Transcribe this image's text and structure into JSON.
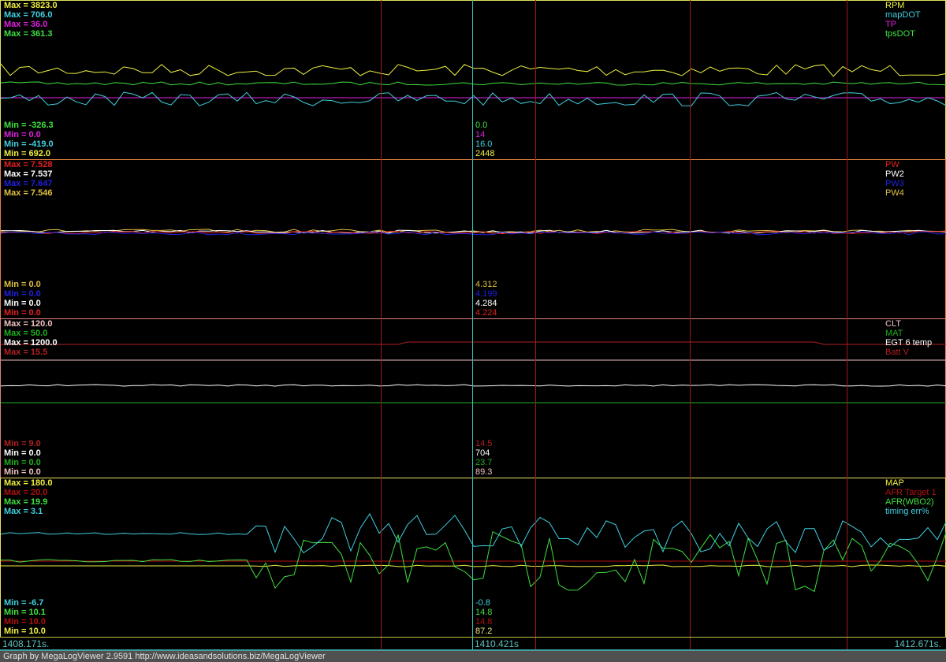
{
  "panels": [
    {
      "border": "#e0e060",
      "max": [
        {
          "t": "Max = 3823.0",
          "c": "#f0f040"
        },
        {
          "t": "Max = 706.0",
          "c": "#40d0e0"
        },
        {
          "t": "Max = 36.0",
          "c": "#e020e0"
        },
        {
          "t": "Max = 361.3",
          "c": "#40e040"
        }
      ],
      "min": [
        {
          "t": "Min = -326.3",
          "c": "#40e040"
        },
        {
          "t": "Min = 0.0",
          "c": "#e020e0"
        },
        {
          "t": "Min = -419.0",
          "c": "#40d0e0"
        },
        {
          "t": "Min = 692.0",
          "c": "#f0f040"
        }
      ],
      "legend": [
        {
          "t": "RPM",
          "c": "#f0f040"
        },
        {
          "t": "mapDOT",
          "c": "#40d0e0"
        },
        {
          "t": "TP",
          "c": "#e020e0"
        },
        {
          "t": "tpsDOT",
          "c": "#40e040"
        }
      ],
      "cursor": [
        {
          "t": "0.0",
          "c": "#40e040"
        },
        {
          "t": "14",
          "c": "#e020e0"
        },
        {
          "t": "16.0",
          "c": "#40d0e0"
        },
        {
          "t": "2448",
          "c": "#f0f040"
        }
      ]
    },
    {
      "border": "#e08040",
      "max": [
        {
          "t": "Max = 7.528",
          "c": "#e02020"
        },
        {
          "t": "Max = 7.537",
          "c": "#ffffff"
        },
        {
          "t": "Max = 7.647",
          "c": "#2020e0"
        },
        {
          "t": "Max = 7.546",
          "c": "#e0c040"
        }
      ],
      "min": [
        {
          "t": "Min = 0.0",
          "c": "#e0c040"
        },
        {
          "t": "Min = 0.0",
          "c": "#2020e0"
        },
        {
          "t": "Min = 0.0",
          "c": "#ffffff"
        },
        {
          "t": "Min = 0.0",
          "c": "#e02020"
        }
      ],
      "legend": [
        {
          "t": "PW",
          "c": "#e02020"
        },
        {
          "t": "PW2",
          "c": "#ffffff"
        },
        {
          "t": "PW3",
          "c": "#2020e0"
        },
        {
          "t": "PW4",
          "c": "#e0c040"
        }
      ],
      "cursor": [
        {
          "t": "4.312",
          "c": "#e0c040"
        },
        {
          "t": "4.199",
          "c": "#2020e0"
        },
        {
          "t": "4.284",
          "c": "#ffffff"
        },
        {
          "t": "4.224",
          "c": "#e02020"
        }
      ]
    },
    {
      "border": "#e08080",
      "max": [
        {
          "t": "Max = 120.0",
          "c": "#f0c0c0"
        },
        {
          "t": "Max = 50.0",
          "c": "#20b020"
        },
        {
          "t": "Max = 1200.0",
          "c": "#ffffff"
        },
        {
          "t": "Max = 15.5",
          "c": "#b02020"
        }
      ],
      "min": [
        {
          "t": "Min = 9.0",
          "c": "#b02020"
        },
        {
          "t": "Min = 0.0",
          "c": "#ffffff"
        },
        {
          "t": "Min = 0.0",
          "c": "#20b020"
        },
        {
          "t": "Min = 0.0",
          "c": "#f0c0c0"
        }
      ],
      "legend": [
        {
          "t": "CLT",
          "c": "#f0c0c0"
        },
        {
          "t": "MAT",
          "c": "#20b020"
        },
        {
          "t": "EGT 6 temp",
          "c": "#ffffff"
        },
        {
          "t": "Batt V",
          "c": "#b02020"
        }
      ],
      "cursor": [
        {
          "t": "14.5",
          "c": "#b02020"
        },
        {
          "t": "704",
          "c": "#ffffff"
        },
        {
          "t": "23.7",
          "c": "#20b020"
        },
        {
          "t": "89.3",
          "c": "#f0c0c0"
        }
      ]
    },
    {
      "border": "#f0e060",
      "max": [
        {
          "t": "Max = 180.0",
          "c": "#f0f040"
        },
        {
          "t": "Max = 20.0",
          "c": "#b01010"
        },
        {
          "t": "Max = 19.9",
          "c": "#40e040"
        },
        {
          "t": "Max = 3.1",
          "c": "#40d0e0"
        }
      ],
      "min": [
        {
          "t": "Min = -6.7",
          "c": "#40d0e0"
        },
        {
          "t": "Min = 10.1",
          "c": "#40e040"
        },
        {
          "t": "Min = 10.0",
          "c": "#b01010"
        },
        {
          "t": "Min = 10.0",
          "c": "#f0f040"
        }
      ],
      "legend": [
        {
          "t": "MAP",
          "c": "#f0f040"
        },
        {
          "t": "AFR Target 1",
          "c": "#b01010"
        },
        {
          "t": "AFR(WBO2)",
          "c": "#40e040"
        },
        {
          "t": "timing err%",
          "c": "#40d0e0"
        }
      ],
      "cursor": [
        {
          "t": "-0.8",
          "c": "#40d0e0"
        },
        {
          "t": "14.8",
          "c": "#40e040"
        },
        {
          "t": "14.8",
          "c": "#b01010"
        },
        {
          "t": "87.2",
          "c": "#f0e080"
        }
      ]
    }
  ],
  "axis": {
    "start": "1408.171s.",
    "cursor": "1410.421s",
    "end": "1412.671s."
  },
  "footer": "Graph by MegaLogViewer 2.9591 http://www.ideasandsolutions.biz/MegaLogViewer"
}
